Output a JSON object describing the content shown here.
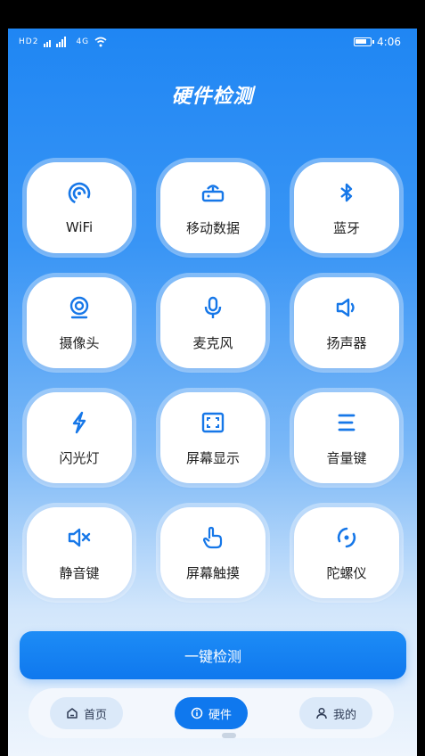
{
  "status": {
    "left_badges": "HD2",
    "signal_text": "4G",
    "time": "4:06"
  },
  "page": {
    "title": "硬件检测"
  },
  "tiles": [
    {
      "label": "WiFi",
      "icon": "wifi-icon"
    },
    {
      "label": "移动数据",
      "icon": "router-icon"
    },
    {
      "label": "蓝牙",
      "icon": "bluetooth-icon"
    },
    {
      "label": "摄像头",
      "icon": "camera-icon"
    },
    {
      "label": "麦克风",
      "icon": "microphone-icon"
    },
    {
      "label": "扬声器",
      "icon": "speaker-icon"
    },
    {
      "label": "闪光灯",
      "icon": "flash-icon"
    },
    {
      "label": "屏幕显示",
      "icon": "screen-icon"
    },
    {
      "label": "音量键",
      "icon": "volume-key-icon"
    },
    {
      "label": "静音键",
      "icon": "mute-icon"
    },
    {
      "label": "屏幕触摸",
      "icon": "touch-icon"
    },
    {
      "label": "陀螺仪",
      "icon": "gyroscope-icon"
    }
  ],
  "actions": {
    "detect_label": "一键检测"
  },
  "tabs": [
    {
      "label": "首页",
      "icon": "home-icon",
      "active": false
    },
    {
      "label": "硬件",
      "icon": "info-icon",
      "active": true
    },
    {
      "label": "我的",
      "icon": "user-icon",
      "active": false
    }
  ],
  "colors": {
    "primary": "#0f78ee",
    "icon": "#1677e8",
    "tile_bg": "#ffffff"
  }
}
